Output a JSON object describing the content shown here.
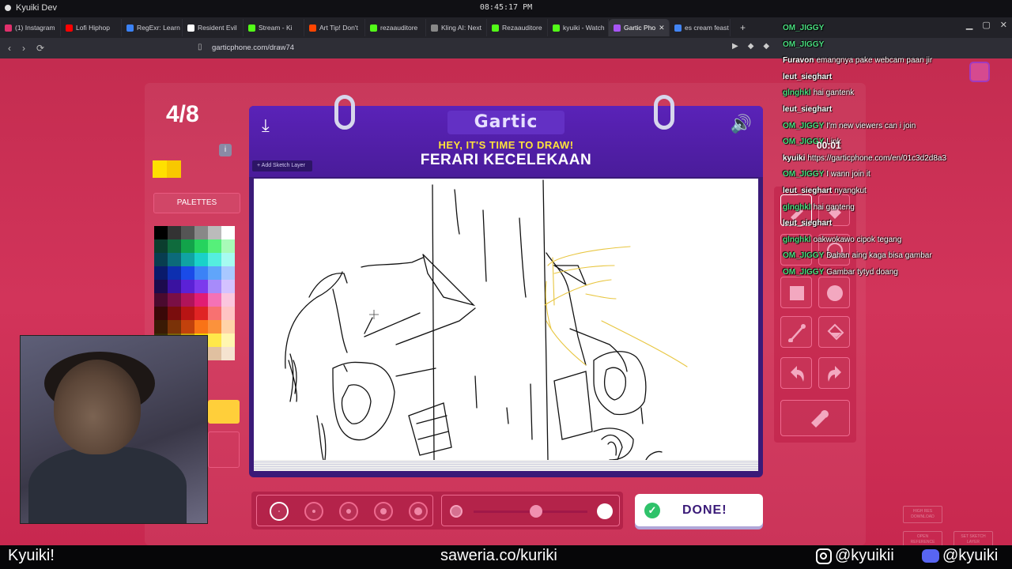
{
  "os": {
    "app_title": "Kyuiki Dev",
    "clock": "08:45:17 PM"
  },
  "browser": {
    "tabs": [
      {
        "label": "(1) Instagram",
        "color": "#e1306c"
      },
      {
        "label": "Lofi Hiphop",
        "color": "#ff0000"
      },
      {
        "label": "RegExr: Learn",
        "color": "#3b82f6"
      },
      {
        "label": "Resident Evil",
        "color": "#ffffff"
      },
      {
        "label": "Stream - Ki",
        "color": "#53fc18"
      },
      {
        "label": "Art Tip! Don't",
        "color": "#ff4500"
      },
      {
        "label": "rezaauditore",
        "color": "#53fc18"
      },
      {
        "label": "Kling AI: Next",
        "color": "#888888"
      },
      {
        "label": "Rezaauditore",
        "color": "#53fc18"
      },
      {
        "label": "kyuiki - Watch",
        "color": "#53fc18"
      },
      {
        "label": "Gartic Pho",
        "color": "#a855f7"
      },
      {
        "label": "es cream feast",
        "color": "#4285f4"
      }
    ],
    "active_tab_index": 10,
    "url": "garticphone.com/draw74"
  },
  "game": {
    "round": "4/8",
    "logo": "Gartic",
    "subtitle": "HEY, IT'S TIME TO DRAW!",
    "prompt": "FERARI KECELEKAAN",
    "sketch_layer_btn": "+ Add Sketch Layer",
    "palettes_label": "PALETTES",
    "done_label": "DONE!",
    "timer": "00:01",
    "selected_color": "#ffe000",
    "brush_sizes": [
      2,
      4,
      6,
      8,
      10
    ],
    "selected_size_index": 0,
    "opacity_level": 0.55,
    "palette_colors": [
      "#000000",
      "#333333",
      "#555555",
      "#888888",
      "#bbbbbb",
      "#ffffff",
      "#0b3d2e",
      "#0f6b3d",
      "#12a34a",
      "#26d35e",
      "#56f07a",
      "#a8fbb8",
      "#083d50",
      "#0c6a7a",
      "#10a3a3",
      "#1ad1c9",
      "#55eedf",
      "#a6fbf1",
      "#0a1a6b",
      "#0d2fb0",
      "#1a4be8",
      "#3b82f6",
      "#60a5fa",
      "#a9c8ff",
      "#1c0b4d",
      "#3a12a0",
      "#5b21d6",
      "#7c3aed",
      "#a78bfa",
      "#d4c2ff",
      "#4a0a2e",
      "#7a0f45",
      "#b0145a",
      "#e11d74",
      "#f472b6",
      "#fbc6de",
      "#3a0808",
      "#7a0d0d",
      "#b81414",
      "#e02424",
      "#f87171",
      "#ffc4c4",
      "#3a1a05",
      "#7a3208",
      "#c2410c",
      "#f97316",
      "#fb923c",
      "#ffd3a8",
      "#3a3005",
      "#7a6208",
      "#c29a0c",
      "#f5d000",
      "#ffe84a",
      "#fff6b0",
      "#4a2e1a",
      "#6d4a2e",
      "#9a6e48",
      "#c49670",
      "#e0c0a0",
      "#f5e3d0"
    ]
  },
  "chat": [
    {
      "user": "OM_JIGGY",
      "color": "#4ade80",
      "text": ""
    },
    {
      "user": "OM_JIGGY",
      "color": "#4ade80",
      "text": ""
    },
    {
      "user": "Furavon",
      "color": "#ffffff",
      "text": "emangnya pake webcam paan jir"
    },
    {
      "user": "leut_sieghart",
      "color": "#ffffff",
      "text": ""
    },
    {
      "user": "glnghkl",
      "color": "#4ade80",
      "text": "hai gantenk"
    },
    {
      "user": "leut_sieghart",
      "color": "#ffffff",
      "text": ""
    },
    {
      "user": "OM_JIGGY",
      "color": "#4ade80",
      "text": "I'm new viewers can i join"
    },
    {
      "user": "OM_JIGGY",
      "color": "#4ade80",
      "text": "Link"
    },
    {
      "user": "kyuiki",
      "color": "#ffffff",
      "text": "https://garticphone.com/en/01c3d2d8a3"
    },
    {
      "user": "OM_JIGGY",
      "color": "#4ade80",
      "text": "I wann join it"
    },
    {
      "user": "leut_sieghart",
      "color": "#ffffff",
      "text": "nyangkut"
    },
    {
      "user": "glnghkl",
      "color": "#4ade80",
      "text": "hai ganteng"
    },
    {
      "user": "leut_sieghart",
      "color": "#ffffff",
      "text": ""
    },
    {
      "user": "glnghkl",
      "color": "#4ade80",
      "text": "oakwokawo cipok tegang"
    },
    {
      "user": "OM_JIGGY",
      "color": "#4ade80",
      "text": "Dahan aing kaga bisa gambar"
    },
    {
      "user": "OM_JIGGY",
      "color": "#4ade80",
      "text": "Gambar tytyd doang"
    }
  ],
  "footer": {
    "left": "Kyuiki!",
    "middle": "saweria.co/kuriki",
    "instagram": "@kyuikii",
    "discord": "@kyuiki"
  },
  "side_buttons": {
    "download": "HIGH RES DOWNLOAD",
    "reference": "OPEN REFERENCE",
    "sketch": "SET SKETCH LAYER"
  }
}
